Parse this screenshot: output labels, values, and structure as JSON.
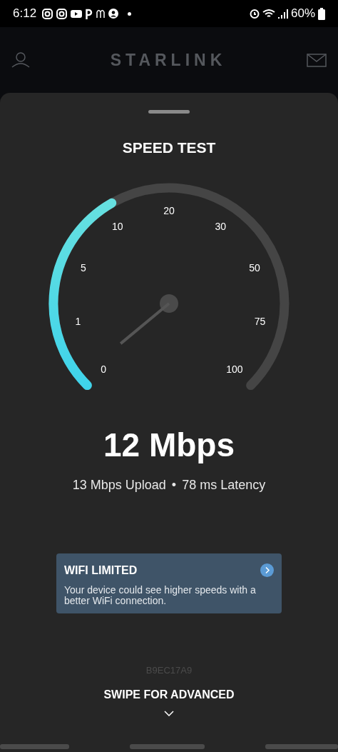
{
  "status_bar": {
    "time": "6:12",
    "battery": "60%"
  },
  "header": {
    "title": "STARLINK"
  },
  "sheet": {
    "title": "SPEED TEST",
    "gauge": {
      "ticks": [
        "0",
        "1",
        "5",
        "10",
        "20",
        "30",
        "50",
        "75",
        "100"
      ]
    },
    "speed": "12 Mbps",
    "upload": "13 Mbps Upload",
    "separator": "•",
    "latency": "78 ms Latency",
    "alert": {
      "title": "WIFI LIMITED",
      "message": "Your device could see higher speeds with a better WiFi connection."
    },
    "device_id": "B9EC17A9",
    "swipe_hint": "SWIPE FOR ADVANCED"
  }
}
